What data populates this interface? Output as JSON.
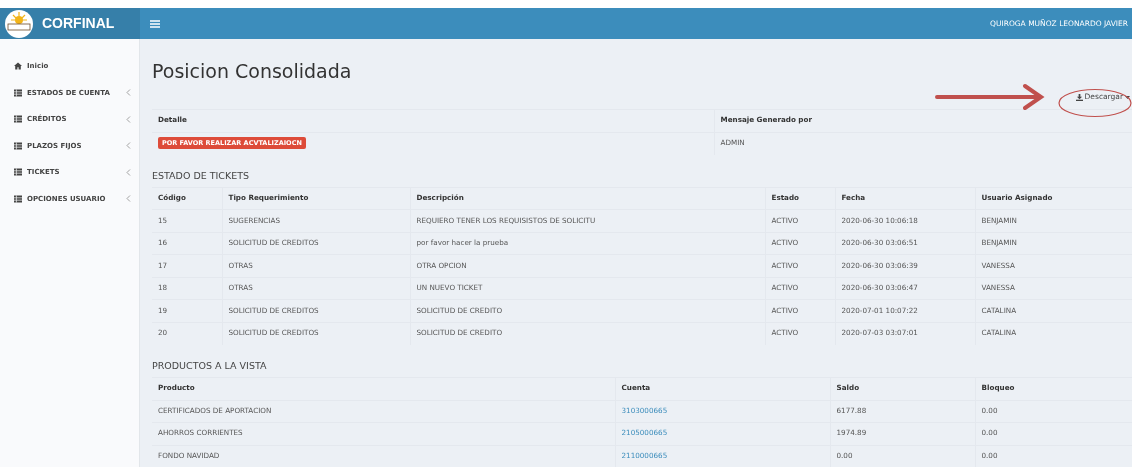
{
  "header": {
    "brand": "CORFINAL",
    "user": "QUIROGA MUÑOZ LEONARDO JAVIER"
  },
  "sidebar": {
    "items": [
      {
        "label": "Inicio",
        "kind": "home",
        "expandable": false
      },
      {
        "label": "ESTADOS DE CUENTA",
        "kind": "list",
        "expandable": true
      },
      {
        "label": "CRÉDITOS",
        "kind": "list",
        "expandable": true
      },
      {
        "label": "PLAZOS FIJOS",
        "kind": "list",
        "expandable": true
      },
      {
        "label": "TICKETS",
        "kind": "list",
        "expandable": true
      },
      {
        "label": "OPCIONES USUARIO",
        "kind": "list",
        "expandable": true
      }
    ]
  },
  "page": {
    "title": "Posicion Consolidada",
    "download_button": "Descargar"
  },
  "message_table": {
    "columns": [
      "Detalle",
      "Mensaje Generado por"
    ],
    "rows": [
      {
        "detail": "POR FAVOR REALIZAR ACVTALIZAIOCN",
        "generated_by": "ADMIN"
      }
    ]
  },
  "tickets": {
    "title": "ESTADO DE TICKETS",
    "columns": [
      "Código",
      "Tipo Requerimiento",
      "Descripción",
      "Estado",
      "Fecha",
      "Usuario Asignado"
    ],
    "rows": [
      [
        "15",
        "SUGERENCIAS",
        "REQUIERO TENER LOS REQUISISTOS DE SOLICITU",
        "ACTIVO",
        "2020-06-30 10:06:18",
        "BENJAMIN"
      ],
      [
        "16",
        "SOLICITUD DE CREDITOS",
        "por favor hacer la prueba",
        "ACTIVO",
        "2020-06-30 03:06:51",
        "BENJAMIN"
      ],
      [
        "17",
        "OTRAS",
        "OTRA OPCION",
        "ACTIVO",
        "2020-06-30 03:06:39",
        "VANESSA"
      ],
      [
        "18",
        "OTRAS",
        "UN NUEVO TICKET",
        "ACTIVO",
        "2020-06-30 03:06:47",
        "VANESSA"
      ],
      [
        "19",
        "SOLICITUD DE CREDITOS",
        "SOLICITUD DE CREDITO",
        "ACTIVO",
        "2020-07-01 10:07:22",
        "CATALINA"
      ],
      [
        "20",
        "SOLICITUD DE CREDITOS",
        "SOLICITUD DE CREDITO",
        "ACTIVO",
        "2020-07-03 03:07:01",
        "CATALINA"
      ]
    ]
  },
  "products": {
    "title": "PRODUCTOS A LA VISTA",
    "columns": [
      "Producto",
      "Cuenta",
      "Saldo",
      "Bloqueo"
    ],
    "rows": [
      [
        "CERTIFICADOS DE APORTACION",
        "3103000665",
        "6177.88",
        "0.00"
      ],
      [
        "AHORROS CORRIENTES",
        "2105000665",
        "1974.89",
        "0.00"
      ],
      [
        "FONDO NAVIDAD",
        "2110000665",
        "0.00",
        "0.00"
      ]
    ]
  }
}
